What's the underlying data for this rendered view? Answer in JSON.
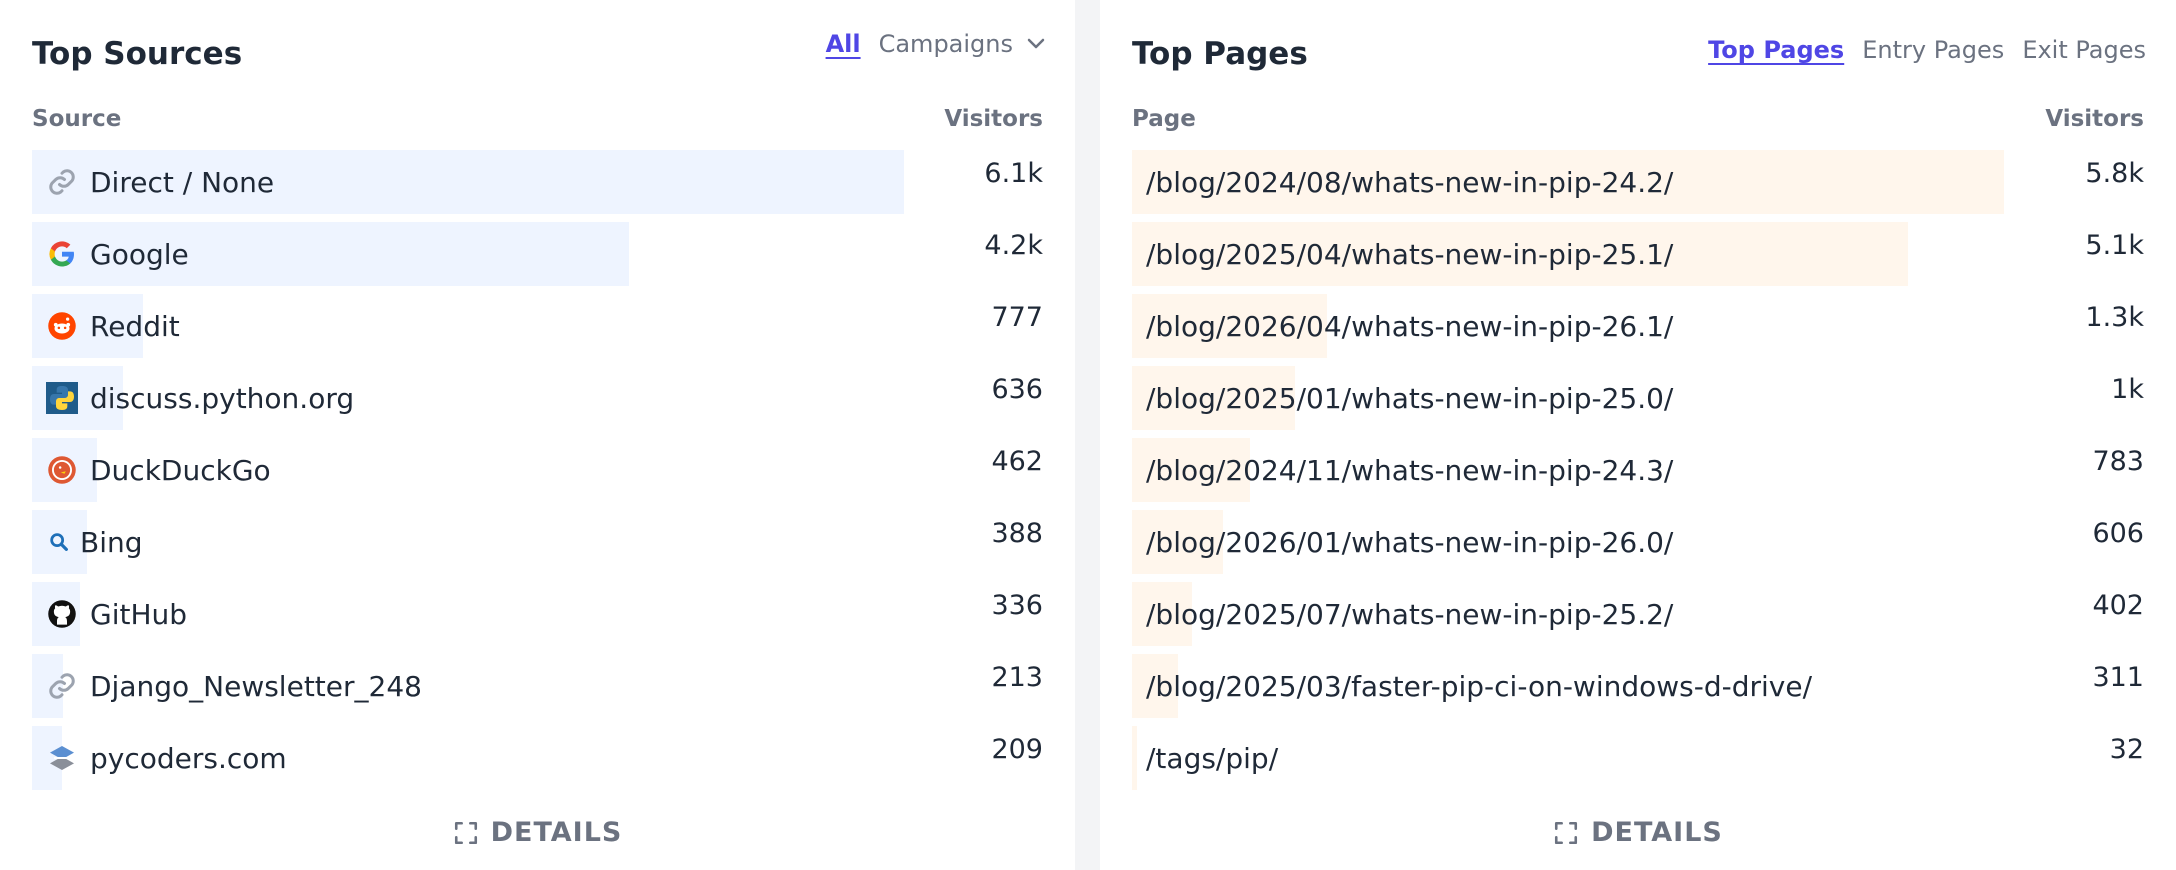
{
  "sources": {
    "title": "Top Sources",
    "tabs": {
      "all": "All",
      "campaigns": "Campaigns"
    },
    "col_source": "Source",
    "col_visitors": "Visitors",
    "items": [
      {
        "label": "Direct / None",
        "value": "6.1k",
        "share": 1.0,
        "icon": "link-icon"
      },
      {
        "label": "Google",
        "value": "4.2k",
        "share": 0.685,
        "icon": "google-icon"
      },
      {
        "label": "Reddit",
        "value": "777",
        "share": 0.127,
        "icon": "reddit-icon"
      },
      {
        "label": "discuss.python.org",
        "value": "636",
        "share": 0.104,
        "icon": "python-icon"
      },
      {
        "label": "DuckDuckGo",
        "value": "462",
        "share": 0.075,
        "icon": "duckduckgo-icon"
      },
      {
        "label": "Bing",
        "value": "388",
        "share": 0.063,
        "icon": "bing-search-icon"
      },
      {
        "label": "GitHub",
        "value": "336",
        "share": 0.055,
        "icon": "github-icon"
      },
      {
        "label": "Django_Newsletter_248",
        "value": "213",
        "share": 0.035,
        "icon": "link-icon"
      },
      {
        "label": "pycoders.com",
        "value": "209",
        "share": 0.034,
        "icon": "pycoders-icon"
      }
    ],
    "details_label": "DETAILS"
  },
  "pages": {
    "title": "Top Pages",
    "tabs": {
      "top": "Top Pages",
      "entry": "Entry Pages",
      "exit": "Exit Pages"
    },
    "col_page": "Page",
    "col_visitors": "Visitors",
    "items": [
      {
        "label": "/blog/2024/08/whats-new-in-pip-24.2/",
        "value": "5.8k",
        "share": 1.0
      },
      {
        "label": "/blog/2025/04/whats-new-in-pip-25.1/",
        "value": "5.1k",
        "share": 0.89
      },
      {
        "label": "/blog/2026/04/whats-new-in-pip-26.1/",
        "value": "1.3k",
        "share": 0.224
      },
      {
        "label": "/blog/2025/01/whats-new-in-pip-25.0/",
        "value": "1k",
        "share": 0.187
      },
      {
        "label": "/blog/2024/11/whats-new-in-pip-24.3/",
        "value": "783",
        "share": 0.135
      },
      {
        "label": "/blog/2026/01/whats-new-in-pip-26.0/",
        "value": "606",
        "share": 0.104
      },
      {
        "label": "/blog/2025/07/whats-new-in-pip-25.2/",
        "value": "402",
        "share": 0.069
      },
      {
        "label": "/blog/2025/03/faster-pip-ci-on-windows-d-drive/",
        "value": "311",
        "share": 0.053
      },
      {
        "label": "/tags/pip/",
        "value": "32",
        "share": 0.006
      }
    ],
    "details_label": "DETAILS"
  },
  "colors": {
    "accent": "#4f46e5",
    "source_bar": "#eef4ff",
    "page_bar": "#fff6ec",
    "muted": "#6b7280"
  }
}
